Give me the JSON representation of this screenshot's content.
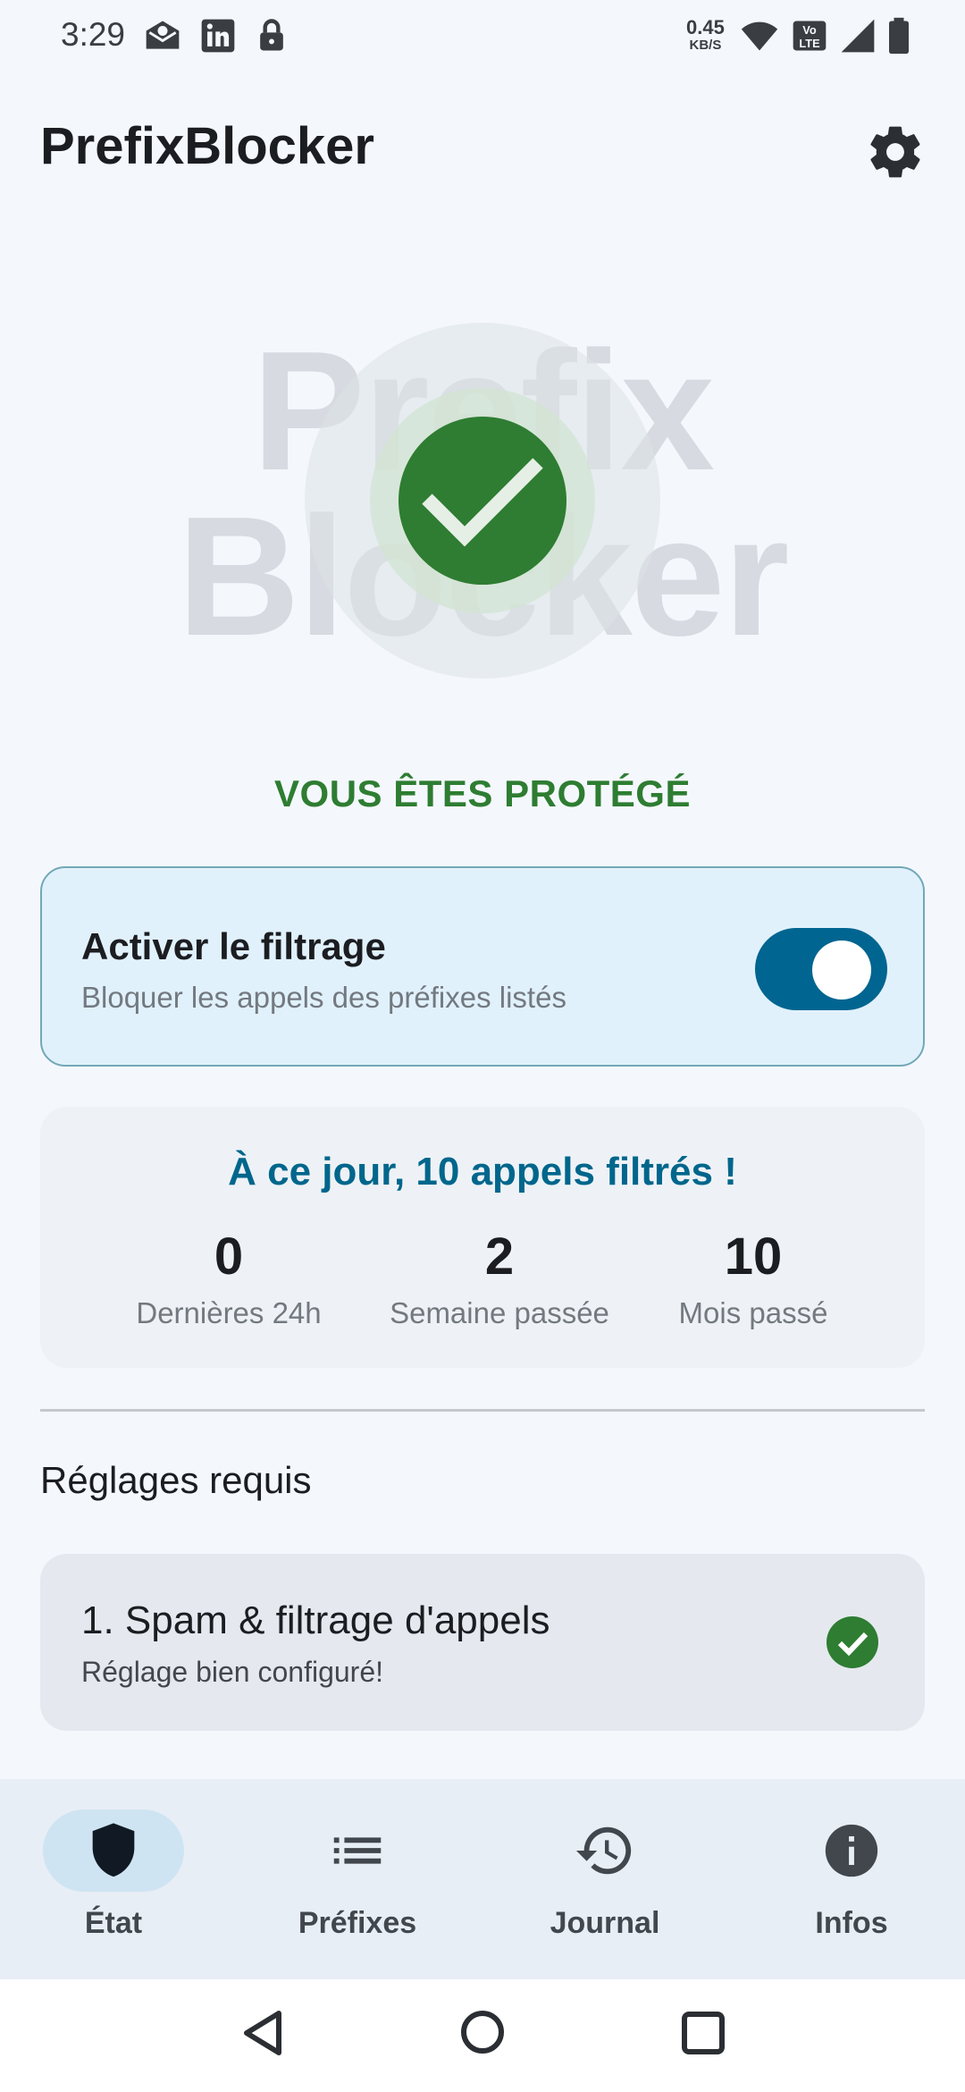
{
  "status_bar": {
    "time": "3:29",
    "net_speed_value": "0.45",
    "net_speed_unit": "KB/S",
    "icons": [
      "mail-icon",
      "linkedin-icon",
      "lock-icon",
      "wifi-icon",
      "volte-icon",
      "signal-icon",
      "battery-icon"
    ]
  },
  "app_bar": {
    "title": "PrefixBlocker",
    "settings_icon": "gear-icon"
  },
  "hero": {
    "watermark_line1": "Prefix",
    "watermark_line2": "Blocker",
    "status_icon": "check-circle-icon",
    "status_text": "VOUS ÊTES PROTÉGÉ",
    "status_color": "#2e7d32"
  },
  "filter_card": {
    "title": "Activer le filtrage",
    "subtitle": "Bloquer les appels des préfixes listés",
    "enabled": true,
    "accent": "#006590"
  },
  "stats": {
    "headline": "À ce jour, 10 appels filtrés !",
    "items": [
      {
        "value": "0",
        "label": "Dernières 24h"
      },
      {
        "value": "2",
        "label": "Semaine passée"
      },
      {
        "value": "10",
        "label": "Mois passé"
      }
    ]
  },
  "settings_section": {
    "title": "Réglages requis",
    "items": [
      {
        "title": "1. Spam & filtrage d'appels",
        "subtitle": "Réglage bien configuré!",
        "status_icon": "check-circle-icon"
      }
    ]
  },
  "bottom_nav": {
    "items": [
      {
        "label": "État",
        "icon": "shield-icon",
        "selected": true
      },
      {
        "label": "Préfixes",
        "icon": "list-icon",
        "selected": false
      },
      {
        "label": "Journal",
        "icon": "history-icon",
        "selected": false
      },
      {
        "label": "Infos",
        "icon": "info-icon",
        "selected": false
      }
    ]
  },
  "system_nav": {
    "icons": [
      "back-icon",
      "home-icon",
      "recents-icon"
    ]
  }
}
